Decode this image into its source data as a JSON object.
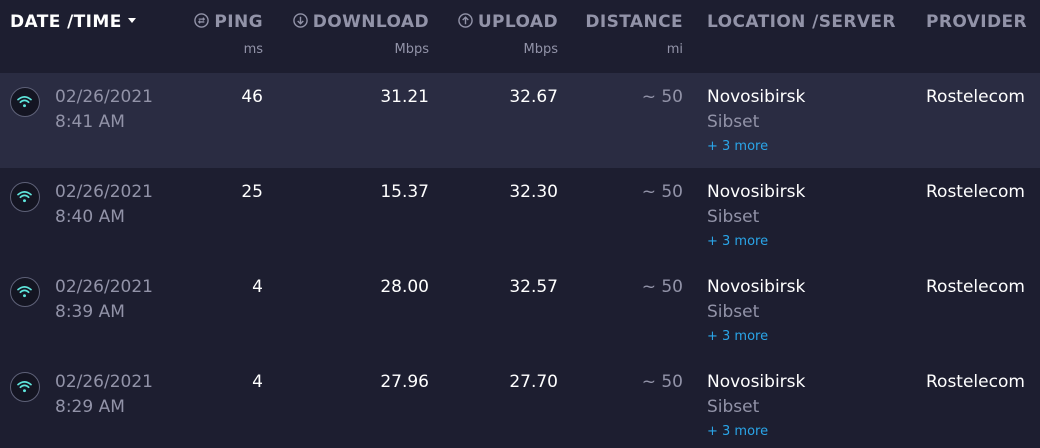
{
  "header": {
    "date_time": "DATE /TIME",
    "ping": "PING",
    "ping_unit": "ms",
    "download": "DOWNLOAD",
    "download_unit": "Mbps",
    "upload": "UPLOAD",
    "upload_unit": "Mbps",
    "distance": "DISTANCE",
    "distance_unit": "mi",
    "location": "LOCATION /SERVER",
    "provider": "PROVIDER"
  },
  "rows": [
    {
      "date": "02/26/2021",
      "time": "8:41 AM",
      "ping": "46",
      "download": "31.21",
      "upload": "32.67",
      "distance": "~ 50",
      "location": "Novosibirsk",
      "server": "Sibset",
      "more": "+ 3 more",
      "provider": "Rostelecom"
    },
    {
      "date": "02/26/2021",
      "time": "8:40 AM",
      "ping": "25",
      "download": "15.37",
      "upload": "32.30",
      "distance": "~ 50",
      "location": "Novosibirsk",
      "server": "Sibset",
      "more": "+ 3 more",
      "provider": "Rostelecom"
    },
    {
      "date": "02/26/2021",
      "time": "8:39 AM",
      "ping": "4",
      "download": "28.00",
      "upload": "32.57",
      "distance": "~ 50",
      "location": "Novosibirsk",
      "server": "Sibset",
      "more": "+ 3 more",
      "provider": "Rostelecom"
    },
    {
      "date": "02/26/2021",
      "time": "8:29 AM",
      "ping": "4",
      "download": "27.96",
      "upload": "27.70",
      "distance": "~ 50",
      "location": "Novosibirsk",
      "server": "Sibset",
      "more": "+ 3 more",
      "provider": "Rostelecom"
    }
  ],
  "icons": {
    "connection": "wifi-icon",
    "ping": "ping-gauge-icon",
    "download": "download-arrow-icon",
    "upload": "upload-arrow-icon",
    "sort": "caret-down-icon"
  },
  "colors": {
    "background": "#1d1e30",
    "highlight_row": "#2a2c42",
    "muted_text": "#9293a8",
    "link": "#2aa5e8",
    "wifi": "#5fe6dc"
  }
}
